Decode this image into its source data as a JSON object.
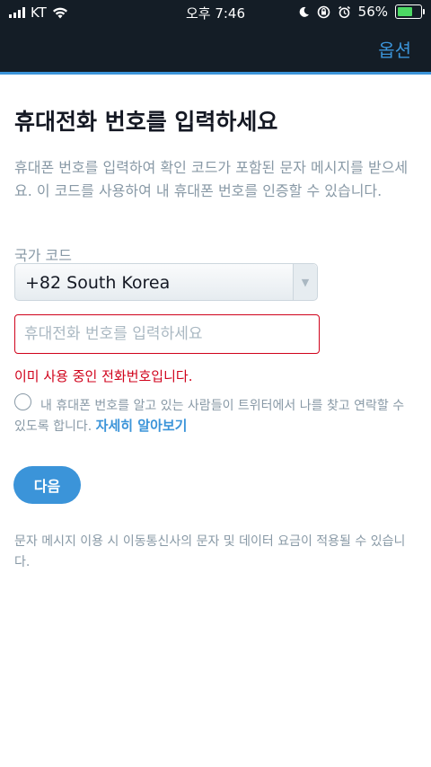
{
  "status_bar": {
    "carrier": "KT",
    "time": "오후 7:46",
    "battery": "56%",
    "battery_level": 0.56
  },
  "header": {
    "options_label": "옵션"
  },
  "main": {
    "title": "휴대전화 번호를 입력하세요",
    "description": "휴대폰 번호를 입력하여 확인 코드가 포함된 문자 메시지를 받으세요. 이 코드를 사용하여 내 휴대폰 번호를 인증할 수 있습니다.",
    "country_label": "국가 코드",
    "country_value": "+82 South Korea",
    "phone_placeholder": "휴대전화 번호를 입력하세요",
    "error_text": "이미 사용 중인 전화번호입니다.",
    "consent_text": "내 휴대폰 번호를 알고 있는 사람들이 트위터에서 나를 찾고 연락할 수 있도록 합니다.",
    "learn_more": "자세히 알아보기",
    "next_button": "다음",
    "footer_note": "문자 메시지 이용 시 이동통신사의 문자 및 데이터 요금이 적용될 수 있습니다."
  },
  "colors": {
    "header_bg": "#141d26",
    "accent": "#3b94d9",
    "error": "#d0021b",
    "muted_text": "#8899a6"
  }
}
